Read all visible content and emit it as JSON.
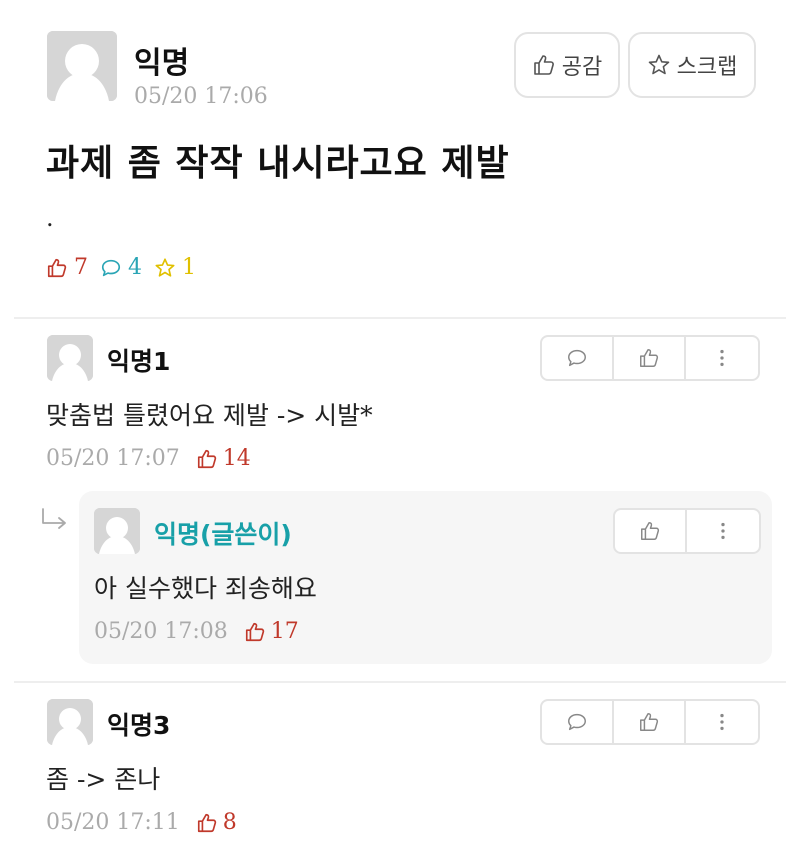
{
  "post": {
    "author": "익명",
    "time": "05/20 17:06",
    "title": "과제 좀 작작 내시라고요 제발",
    "body": ".",
    "like_button_label": "공감",
    "scrap_button_label": "스크랩",
    "stats": {
      "likes": "7",
      "comments": "4",
      "scraps": "1"
    }
  },
  "comments": [
    {
      "author": "익명1",
      "text": "맞춤법 틀렸어요 제발 -> 시발*",
      "time": "05/20 17:07",
      "likes": "14"
    },
    {
      "author": "익명(글쓴이)",
      "text": "아 실수했다 죄송해요",
      "time": "05/20 17:08",
      "likes": "17",
      "is_reply": true
    },
    {
      "author": "익명3",
      "text": "좀 -> 존나",
      "time": "05/20 17:11",
      "likes": "8"
    }
  ],
  "colors": {
    "like": "#c0392b",
    "comment": "#2aa5b5",
    "scrap": "#e0c000",
    "writer": "#18a0a8"
  },
  "icons": [
    "thumbs-up-icon",
    "star-icon",
    "comment-icon",
    "more-icon",
    "reply-arrow-icon",
    "avatar-icon"
  ]
}
